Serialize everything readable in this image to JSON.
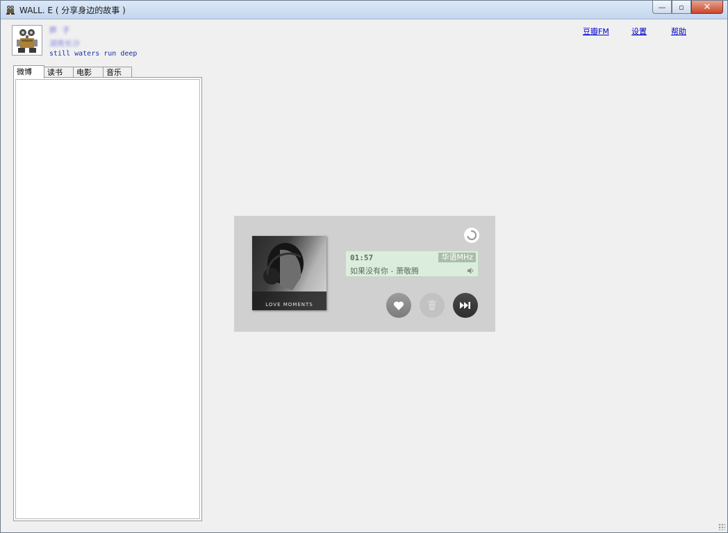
{
  "window": {
    "title": "WALL. E ( 分享身边的故事 )",
    "controls": {
      "minimize": "—",
      "maximize": "▫",
      "close": "✕"
    }
  },
  "profile": {
    "name": "胖 子",
    "subtitle": "湖南长沙",
    "motto": "still waters run deep",
    "avatar_icon": "robot-avatar-icon"
  },
  "links": [
    "豆瓣FM",
    "设置",
    "帮助"
  ],
  "tabs": [
    "微博",
    "读书",
    "电影",
    "音乐"
  ],
  "active_tab": 0,
  "player": {
    "cover_text": "LOVE MOMENTS",
    "time": "01:57",
    "channel": "华语MHz",
    "song": "如果没有你 - 萧敬腾",
    "buttons": {
      "like": "heart-icon",
      "trash": "trash-icon",
      "next": "next-icon"
    }
  },
  "colors": {
    "link": "#0000cc",
    "motto": "#1c2fa6",
    "player_bg": "#d0d0d0",
    "info_bg": "#dbeedd"
  }
}
